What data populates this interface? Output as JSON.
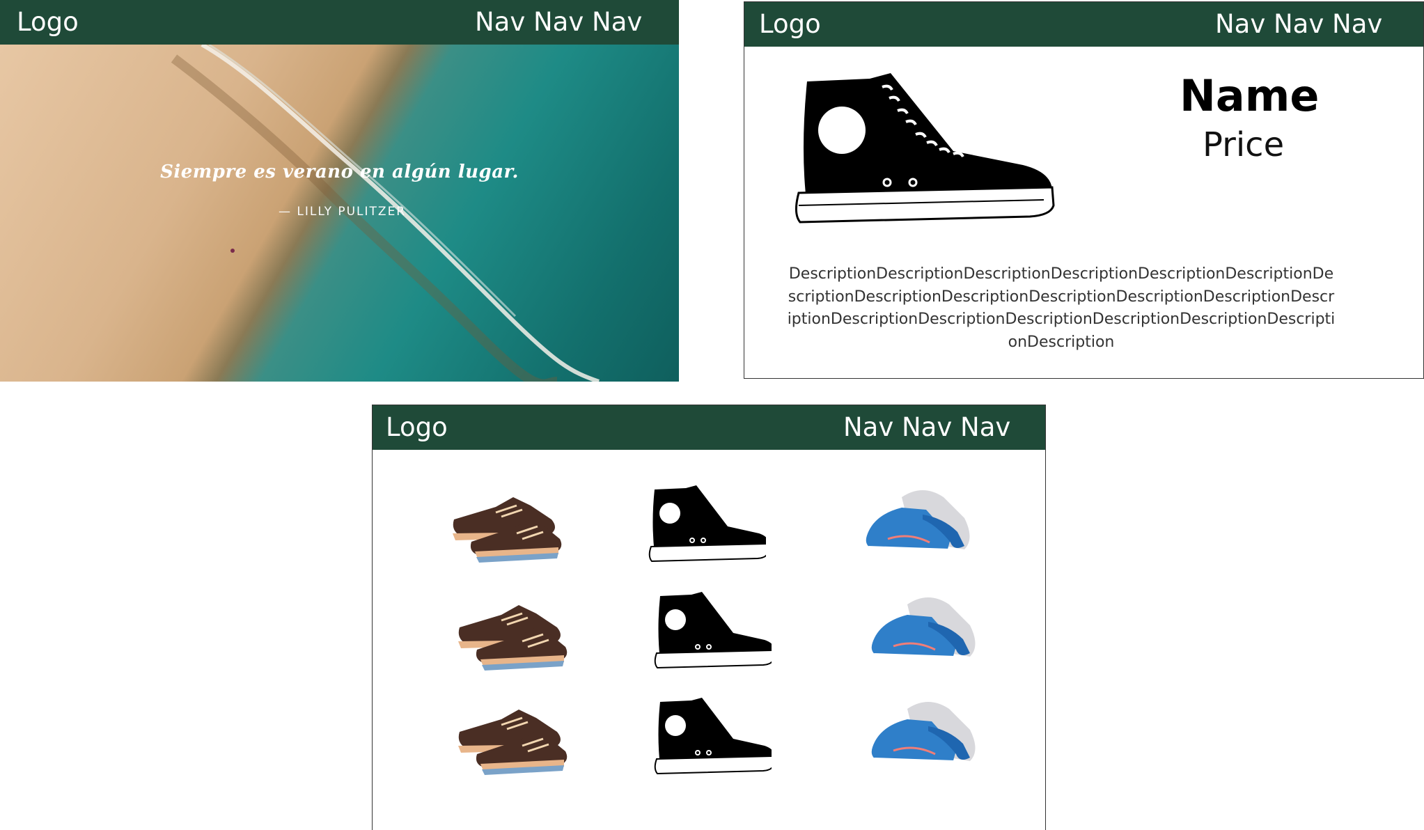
{
  "mockups": [
    {
      "navbar": {
        "logo": "Logo",
        "nav": "Nav Nav Nav"
      },
      "hero": {
        "quote": "Siempre es verano en algún lugar.",
        "author": "— LILLY PULITZER"
      }
    },
    {
      "navbar": {
        "logo": "Logo",
        "nav": "Nav Nav Nav"
      },
      "product": {
        "name": "Name",
        "price": "Price",
        "description": "DescriptionDescriptionDescriptionDescriptionDescriptionDescriptionDescriptionDescriptionDescriptionDescriptionDescriptionDescriptionDescriptionDescriptionDescriptionDescriptionDescriptionDescriptionDescriptionDescription"
      }
    },
    {
      "navbar": {
        "logo": "Logo",
        "nav": "Nav Nav Nav"
      },
      "grid": {
        "columns": [
          "brown-sneakers",
          "black-hightop",
          "blue-running-shoes"
        ],
        "rows": 3
      }
    }
  ],
  "colors": {
    "navbar_bg": "#1f4a38",
    "navbar_text": "#ffffff",
    "sea": "#1e8b86",
    "sand": "#e2c09b"
  },
  "icons": {
    "brown": "brown-sneaker-icon",
    "hightop": "black-hightop-sneaker-icon",
    "blue": "blue-running-shoe-icon"
  }
}
